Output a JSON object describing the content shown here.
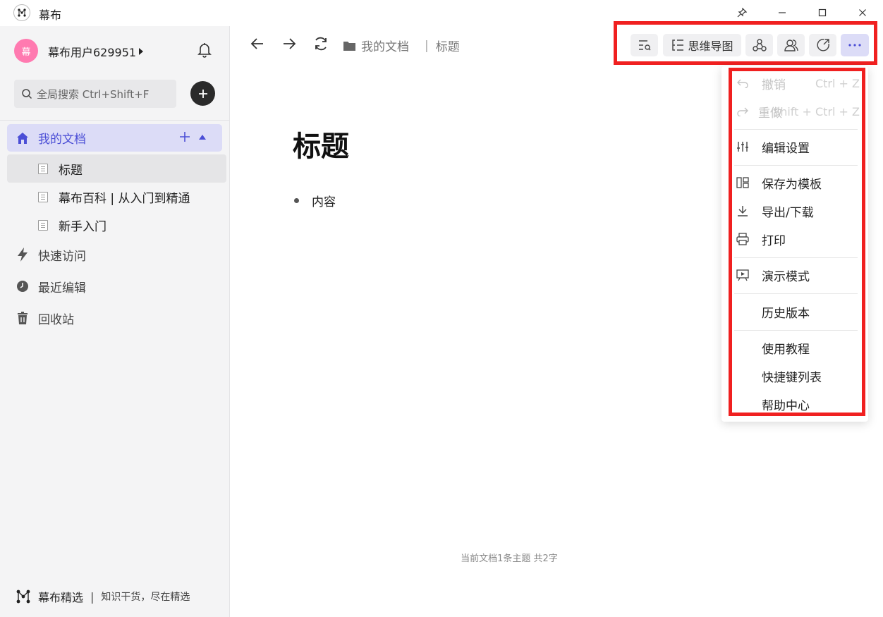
{
  "app": {
    "title": "幕布",
    "window_controls": [
      "pin-icon",
      "minimize-icon",
      "maximize-icon",
      "close-icon"
    ]
  },
  "sidebar": {
    "avatar_text": "幕",
    "user_name": "幕布用户629951",
    "search_placeholder": "全局搜索 Ctrl+Shift+F",
    "my_docs_label": "我的文档",
    "docs": [
      {
        "label": "标题"
      },
      {
        "label": "幕布百科 | 从入门到精通"
      },
      {
        "label": "新手入门"
      }
    ],
    "nav": [
      {
        "label": "快速访问",
        "icon": "lightning-icon"
      },
      {
        "label": "最近编辑",
        "icon": "clock-icon"
      },
      {
        "label": "回收站",
        "icon": "trash-icon"
      }
    ],
    "footer": {
      "brand": "幕布精选",
      "separator": "|",
      "slogan": "知识干货，尽在精选"
    }
  },
  "main": {
    "breadcrumb": {
      "folder": "我的文档",
      "separator": "|",
      "current": "标题"
    },
    "toolbar": {
      "mindmap_label": "思维导图",
      "buttons": [
        "outline-search-icon",
        "mindmap-icon",
        "share-icon",
        "collaborate-icon",
        "publish-icon",
        "more-icon"
      ]
    },
    "document": {
      "title": "标题",
      "bullets": [
        "内容"
      ]
    },
    "status": "当前文档1条主题 共2字"
  },
  "menu": {
    "undo": {
      "label": "撤销",
      "shortcut": "Ctrl + Z"
    },
    "redo": {
      "label": "重做",
      "shortcut": "Shift + Ctrl + Z"
    },
    "edit_settings": "编辑设置",
    "save_template": "保存为模板",
    "export": "导出/下载",
    "print": "打印",
    "presentation": "演示模式",
    "history": "历史版本",
    "tutorial": "使用教程",
    "shortcuts": "快捷键列表",
    "help": "帮助中心"
  },
  "colors": {
    "accent": "#4b4ed6",
    "accent_bg": "#dcdcf7",
    "highlight_red": "#f02020",
    "avatar": "#ff7ab0"
  }
}
